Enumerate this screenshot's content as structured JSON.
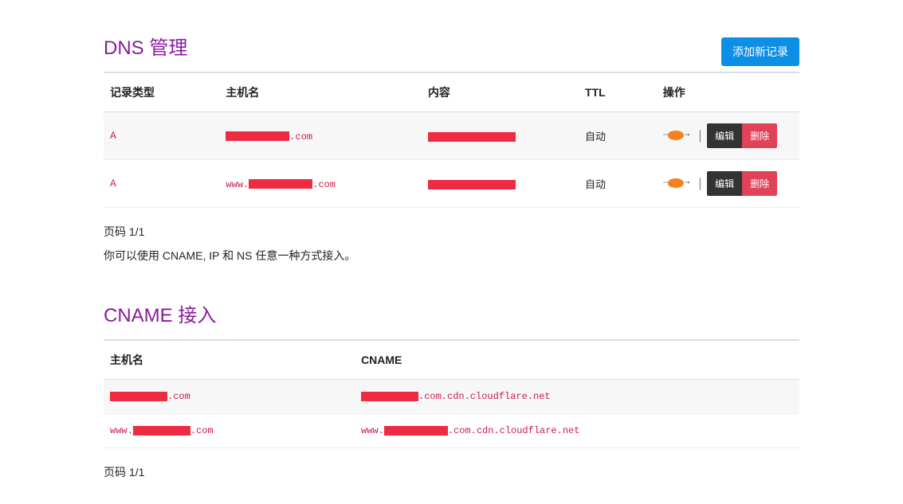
{
  "dns": {
    "title": "DNS 管理",
    "add_label": "添加新记录",
    "headers": {
      "type": "记录类型",
      "host": "主机名",
      "content": "内容",
      "ttl": "TTL",
      "actions": "操作"
    },
    "rows": [
      {
        "type": "A",
        "host_suffix": ".com",
        "www_prefix": "",
        "ttl": "自动"
      },
      {
        "type": "A",
        "host_suffix": ".com",
        "www_prefix": "www.",
        "ttl": "自动"
      }
    ],
    "edit_label": "编辑",
    "delete_label": "删除",
    "page_info": "页码 1/1",
    "note": "你可以使用 CNAME, IP 和 NS 任意一种方式接入。"
  },
  "cname": {
    "title": "CNAME 接入",
    "headers": {
      "host": "主机名",
      "cname": "CNAME"
    },
    "rows": [
      {
        "www_prefix": "",
        "host_suffix": ".com",
        "cname_suffix": ".com.cdn.cloudflare.net"
      },
      {
        "www_prefix": "www.",
        "host_suffix": ".com",
        "cname_suffix": ".com.cdn.cloudflare.net"
      }
    ],
    "page_info": "页码 1/1"
  }
}
